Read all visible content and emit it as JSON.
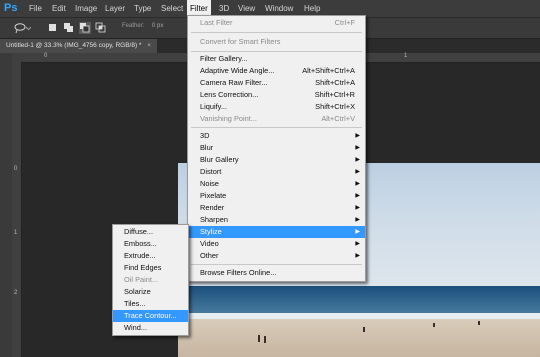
{
  "menubar": {
    "logo": "Ps",
    "items": [
      "File",
      "Edit",
      "Image",
      "Layer",
      "Type",
      "Select",
      "Filter",
      "3D",
      "View",
      "Window",
      "Help"
    ]
  },
  "optionsbar": {
    "feather_label": "Feather:",
    "feather_value": "0 px"
  },
  "document_tab": {
    "title": "Untitled-1 @ 33.3% (IMG_4756 copy, RGB/8) *",
    "close": "×"
  },
  "ruler": {
    "top": [
      "0",
      "1"
    ],
    "left": [
      "0",
      "1",
      "2"
    ]
  },
  "filter_menu": {
    "last_filter": {
      "label": "Last Filter",
      "shortcut": "Ctrl+F"
    },
    "convert_smart": "Convert for Smart Filters",
    "filter_gallery": "Filter Gallery...",
    "adaptive_wide": {
      "label": "Adaptive Wide Angle...",
      "shortcut": "Alt+Shift+Ctrl+A"
    },
    "camera_raw": {
      "label": "Camera Raw Filter...",
      "shortcut": "Shift+Ctrl+A"
    },
    "lens_correction": {
      "label": "Lens Correction...",
      "shortcut": "Shift+Ctrl+R"
    },
    "liquify": {
      "label": "Liquify...",
      "shortcut": "Shift+Ctrl+X"
    },
    "vanishing_point": {
      "label": "Vanishing Point...",
      "shortcut": "Alt+Ctrl+V"
    },
    "submenus": [
      "3D",
      "Blur",
      "Blur Gallery",
      "Distort",
      "Noise",
      "Pixelate",
      "Render",
      "Sharpen",
      "Stylize",
      "Video",
      "Other"
    ],
    "browse_online": "Browse Filters Online..."
  },
  "stylize_submenu": {
    "items": [
      "Diffuse...",
      "Emboss...",
      "Extrude...",
      "Find Edges",
      "Oil Paint...",
      "Solarize",
      "Tiles...",
      "Trace Contour...",
      "Wind..."
    ]
  },
  "colors": {
    "accent": "#3398ff",
    "menu_bg": "#f0f0f0",
    "app_bg": "#282828"
  }
}
